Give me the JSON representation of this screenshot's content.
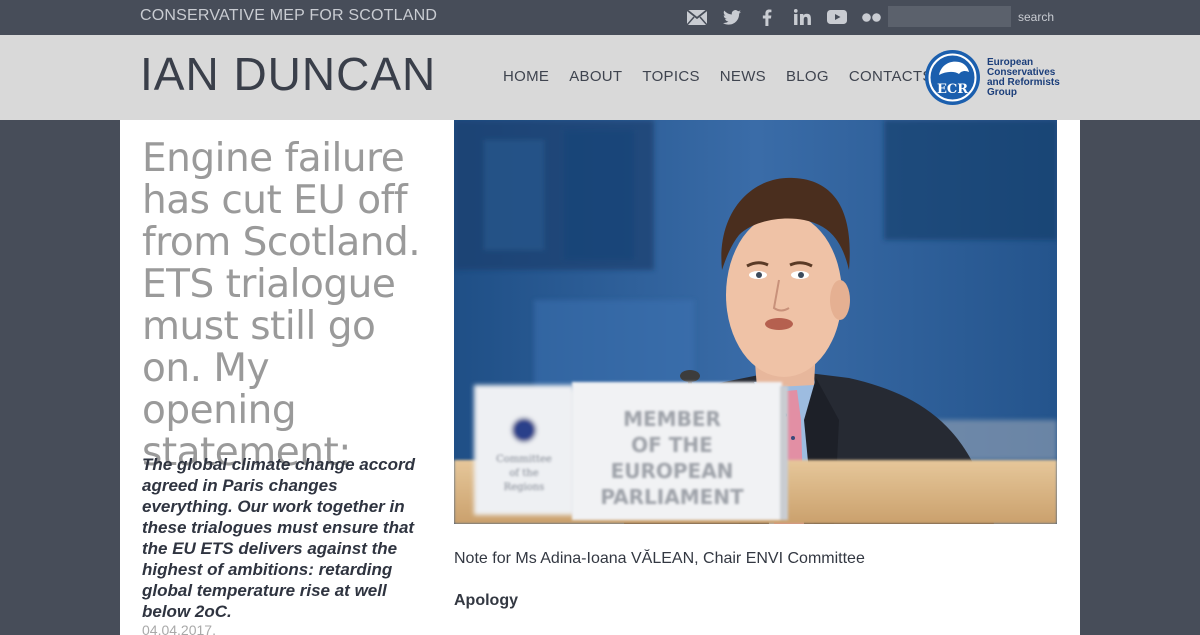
{
  "topbar": {
    "tagline": "CONSERVATIVE MEP FOR SCOTLAND",
    "social_icons": [
      "mail-icon",
      "twitter-icon",
      "facebook-icon",
      "linkedin-icon",
      "youtube-icon",
      "flickr-icon"
    ],
    "search": {
      "value": "",
      "placeholder": "",
      "button_label": "search"
    }
  },
  "header": {
    "site_title": "IAN DUNCAN",
    "nav": [
      "HOME",
      "ABOUT",
      "TOPICS",
      "NEWS",
      "BLOG",
      "CONTACTS"
    ],
    "ecr_logo": {
      "mark": "ECR",
      "lines": [
        "European",
        "Conservatives",
        "and Reformists",
        "Group"
      ]
    }
  },
  "article": {
    "title": "Engine failure has cut EU off from Scotland. ETS trialogue must still go on. My opening statement:",
    "lead": "The global climate change accord agreed in Paris changes everything. Our work together in these trialogues must ensure that the EU ETS delivers against the highest of ambitions: retarding global temperature rise at well below 2oC.",
    "date": "04.04.2017.",
    "photo": {
      "sign_lines": [
        "MEMBER",
        "OF THE",
        "EUROPEAN",
        "PARLIAMENT"
      ],
      "side_sign_lines": [
        "Committee",
        "of the",
        "Regions"
      ]
    },
    "note": "Note for Ms Adina-Ioana VĂLEAN, Chair ENVI Committee",
    "subhead": "Apology"
  },
  "colors": {
    "dark_bg": "#474d59",
    "header_bg": "#d9d9d9",
    "title_gray": "#9a9a9a",
    "ecr_blue": "#1b5fae"
  }
}
